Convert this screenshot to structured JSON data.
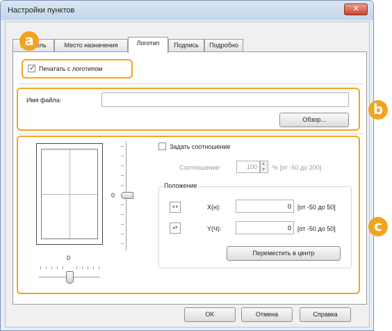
{
  "window": {
    "title": "Настройки пунктов",
    "close_symbol": "✕"
  },
  "tabs": [
    {
      "label": "...вытель"
    },
    {
      "label": "Место назначения"
    },
    {
      "label": "Логотип"
    },
    {
      "label": "Подпись"
    },
    {
      "label": "Подробно"
    }
  ],
  "print_logo": {
    "label": "Печатать с логотипом",
    "checked": true
  },
  "file": {
    "label": "Имя файла:",
    "value": "",
    "browse_label": "Обзор..."
  },
  "preview": {
    "vertical_value": "0",
    "horizontal_value": "0"
  },
  "ratio": {
    "checkbox_label": "Задать соотношение",
    "field_label": "Соотношение:",
    "value": "100",
    "unit_range": "% [от -50 до 200]"
  },
  "position": {
    "group_label": "Положение",
    "x_label": "X(н):",
    "x_value": "0",
    "x_range": "[от -50 до 50]",
    "y_label": "Y(Ч):",
    "y_value": "0",
    "y_range": "[от -50 до 50]",
    "center_button": "Переместить в центр"
  },
  "footer": {
    "ok": "OK",
    "cancel": "Отмена",
    "help": "Справка"
  },
  "callouts": {
    "a": "a",
    "b": "b",
    "c": "c"
  },
  "colors": {
    "callout": "#f3a31e",
    "title_bar": "#c4d5ea"
  }
}
